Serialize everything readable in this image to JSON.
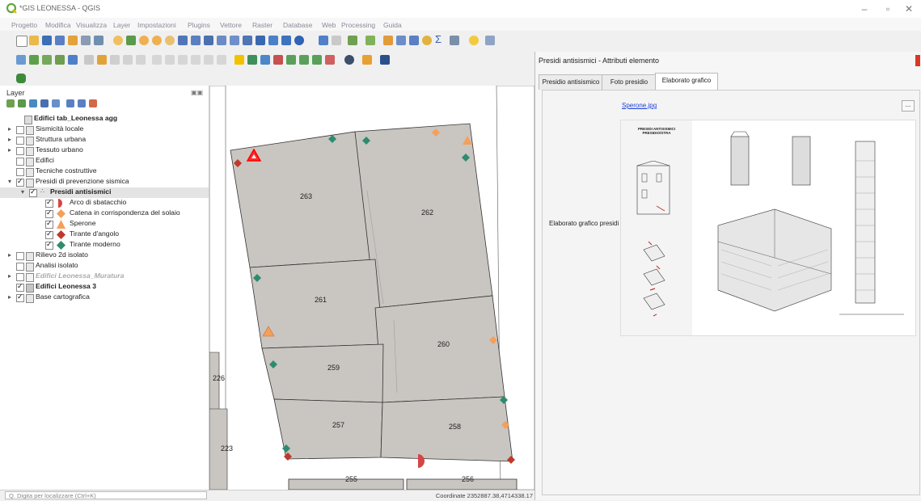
{
  "window": {
    "title": "*GIS LEONESSA - QGIS"
  },
  "menu": [
    "Progetto",
    "Modifica",
    "Visualizza",
    "Layer",
    "Impostazioni",
    "Plugins",
    "Vettore",
    "Raster",
    "Database",
    "Web",
    "Processing",
    "Guida"
  ],
  "layers_panel": {
    "title": "Layer",
    "items": [
      {
        "label": "Edifici tab_Leonessa agg",
        "bold": true,
        "checked": false
      },
      {
        "label": "Sismicità locale",
        "checked": false
      },
      {
        "label": "Struttura urbana",
        "checked": false
      },
      {
        "label": "Tessuto urbano",
        "checked": false
      },
      {
        "label": "Edifici",
        "checked": false
      },
      {
        "label": "Tecniche costruttive",
        "checked": false
      },
      {
        "label": "Presidi di prevenzione sismica",
        "checked": true
      },
      {
        "label": "Presidi antisismici",
        "bold": true,
        "checked": true
      },
      {
        "label": "Arco di sbatacchio",
        "checked": true,
        "symbol": "half-circle",
        "color": "#d64545"
      },
      {
        "label": "Catena in corrispondenza del solaio",
        "checked": true,
        "symbol": "diamond",
        "color": "#f5a05a"
      },
      {
        "label": "Sperone",
        "checked": true,
        "symbol": "triangle",
        "color": "#f5a05a"
      },
      {
        "label": "Tirante d'angolo",
        "checked": true,
        "symbol": "diamond",
        "color": "#c0392b"
      },
      {
        "label": "Tirante moderno",
        "checked": true,
        "symbol": "diamond",
        "color": "#2e8b6f"
      },
      {
        "label": "Rilievo 2d isolato",
        "checked": false
      },
      {
        "label": "Analisi isolato",
        "checked": false
      },
      {
        "label": "Edifici Leonessa_Muratura",
        "checked": false,
        "italic": true
      },
      {
        "label": "Edifici Leonessa 3",
        "bold": true,
        "checked": true
      },
      {
        "label": "Base cartografica",
        "checked": true
      }
    ]
  },
  "map": {
    "parcels": [
      "263",
      "262",
      "261",
      "260",
      "259",
      "258",
      "257",
      "256",
      "255",
      "226",
      "223"
    ]
  },
  "attribute_dialog": {
    "title": "Presidi antisismici - Attributi elemento",
    "tabs": [
      "Presidio antisismico",
      "Foto presidio",
      "Elaborato grafico"
    ],
    "active_tab": "Elaborato grafico",
    "field_label": "Elaborato grafico presidi",
    "file_link": "Sperone.jpg",
    "browse_button": "...",
    "drawing_heading": "PRESIDI ANTISISMICI PRESIDIO/STRA"
  },
  "status": {
    "locate_placeholder": "Q. Digita per localizzare (Ctrl+K)",
    "coordinates": "Coordinate 2352887.38,4714338.17"
  },
  "colors": {
    "parcel_fill": "#c9c5c1",
    "tirante_moderno": "#2e8b6f",
    "catena": "#f5a05a",
    "tirante_angolo": "#c0392b",
    "link": "#1a3fd6"
  }
}
